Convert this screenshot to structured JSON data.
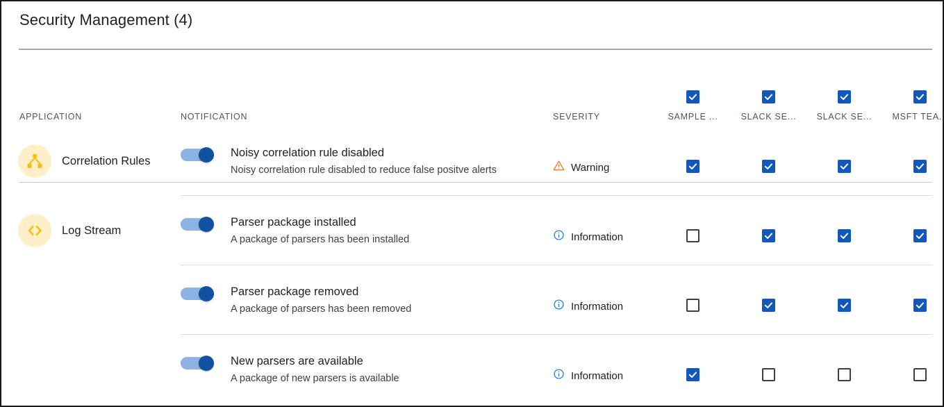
{
  "panel": {
    "title": "Security Management (4)"
  },
  "columns": {
    "application": "APPLICATION",
    "notification": "NOTIFICATION",
    "severity": "SEVERITY",
    "channels": [
      {
        "label": "SAMPLE ...",
        "checked": true
      },
      {
        "label": "SLACK SE...",
        "checked": true
      },
      {
        "label": "SLACK SE...",
        "checked": true
      },
      {
        "label": "MSFT TEA...",
        "checked": true
      }
    ]
  },
  "colors": {
    "accent_blue": "#1258ba",
    "toggle_knob": "#10529f",
    "toggle_track": "#8cb3e2",
    "app_icon_bg": "#fdf0c9",
    "app_icon_fg": "#fbbc04",
    "warning_orange": "#f07122",
    "info_blue": "#1a73c8",
    "border_dark": "#1a1a1a",
    "rule_gray": "#a9a9a9",
    "row_divider": "#dcdfe3"
  },
  "rows": [
    {
      "application": "Correlation Rules",
      "app_icon": "hierarchy-icon",
      "show_application": true,
      "toggle_on": true,
      "notification_title": "Noisy correlation rule disabled",
      "notification_desc": "Noisy correlation rule disabled to reduce false positve alerts",
      "severity": "Warning",
      "severity_icon": "warning-triangle-icon",
      "channels": [
        true,
        true,
        true,
        true
      ]
    },
    {
      "application": "Log Stream",
      "app_icon": "code-brackets-icon",
      "show_application": true,
      "toggle_on": true,
      "notification_title": "Parser package installed",
      "notification_desc": "A package of parsers has been installed",
      "severity": "Information",
      "severity_icon": "info-circle-icon",
      "channels": [
        false,
        true,
        true,
        true
      ]
    },
    {
      "application": "",
      "app_icon": "",
      "show_application": false,
      "toggle_on": true,
      "notification_title": "Parser package removed",
      "notification_desc": "A package of parsers has been removed",
      "severity": "Information",
      "severity_icon": "info-circle-icon",
      "channels": [
        false,
        true,
        true,
        true
      ]
    },
    {
      "application": "",
      "app_icon": "",
      "show_application": false,
      "toggle_on": true,
      "notification_title": "New parsers are available",
      "notification_desc": "A package of new parsers is available",
      "severity": "Information",
      "severity_icon": "info-circle-icon",
      "channels": [
        true,
        false,
        false,
        false
      ]
    }
  ]
}
